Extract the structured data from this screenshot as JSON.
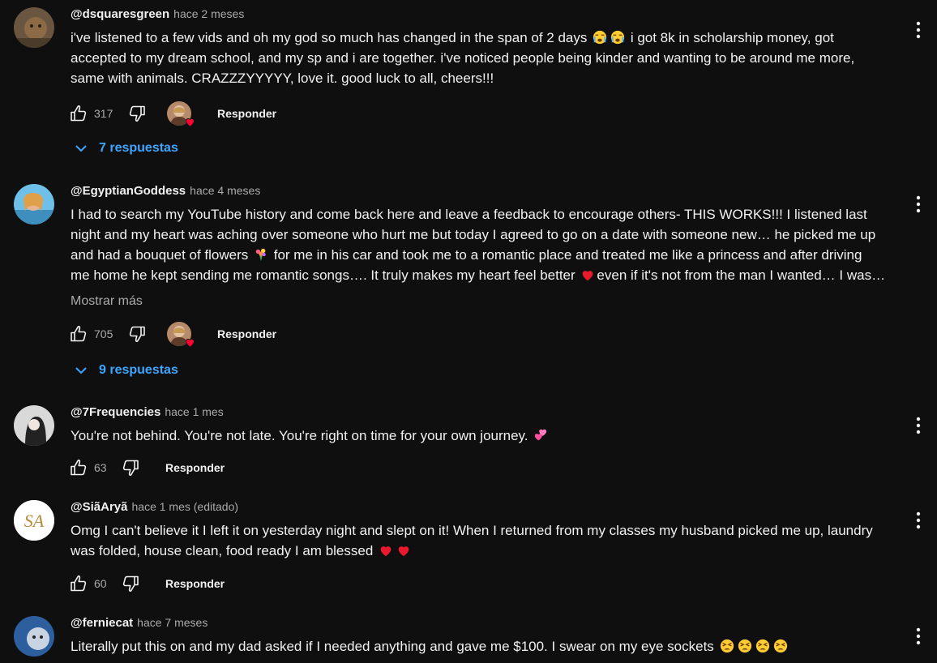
{
  "ui": {
    "reply_label": "Responder",
    "show_more_label": "Mostrar más"
  },
  "comments": [
    {
      "author": "@dsquaresgreen",
      "time": "hace 2 meses",
      "lines": [
        "i've listened to a few vids and oh my god so much has changed in the span of 2 days",
        "i got 8k in scholarship money, got",
        "accepted to my dream school, and my sp and i are together. i've noticed people being kinder and wanting to be around me more,",
        "same with animals. CRAZZZYYYYY, love it. good luck to all, cheers!!!"
      ],
      "likes": "317",
      "replies": "7 respuestas",
      "icons": [
        "thumb-up-icon",
        "thumb-down-icon",
        "loudly-crying-emoji"
      ]
    },
    {
      "author": "@EgyptianGoddess",
      "time": "hace 4 meses",
      "lines": [
        "I had to search my YouTube history and come back here and leave a feedback to encourage others- THIS WORKS!!! I listened last",
        "night and my heart was aching over someone who hurt me but today I agreed to go on a date with someone new… he picked me up",
        "and had a bouquet of flowers",
        "for me in his car and took me to a romantic place and treated me like a princess and  after driving",
        "me home he kept sending me romantic songs…. It truly makes my heart feel better",
        "even if it's not from the man I wanted… I was…"
      ],
      "likes": "705",
      "replies": "9 respuestas",
      "icons": [
        "bouquet-emoji",
        "red-heart-emoji"
      ]
    },
    {
      "author": "@7Frequencies",
      "time": "hace 1 mes",
      "lines": [
        "You're not behind. You're not late. You're right on time for your own journey."
      ],
      "likes": "63",
      "icons": [
        "two-hearts-emoji"
      ]
    },
    {
      "author": "@SiãAryã",
      "time": "hace 1 mes (editado)",
      "lines": [
        "Omg I can't believe it I left it on yesterday night and slept on it! When I returned from my classes my husband picked me up, laundry",
        "was folded, house clean, food ready I am blessed"
      ],
      "likes": "60",
      "avatar_text": "SA",
      "icons": [
        "red-heart-emoji"
      ]
    },
    {
      "author": "@ferniecat",
      "time": "hace 7 meses",
      "lines": [
        "Literally put this on and my dad asked if I needed anything and gave me $100. I swear on my eye sockets"
      ],
      "icons": [
        "tired-face-emoji"
      ]
    }
  ],
  "colors": {
    "background": "#0f0f0f",
    "text": "#f1f1f1",
    "muted": "#aaaaaa",
    "link": "#3ea6ff",
    "heart": "#ff0033"
  }
}
